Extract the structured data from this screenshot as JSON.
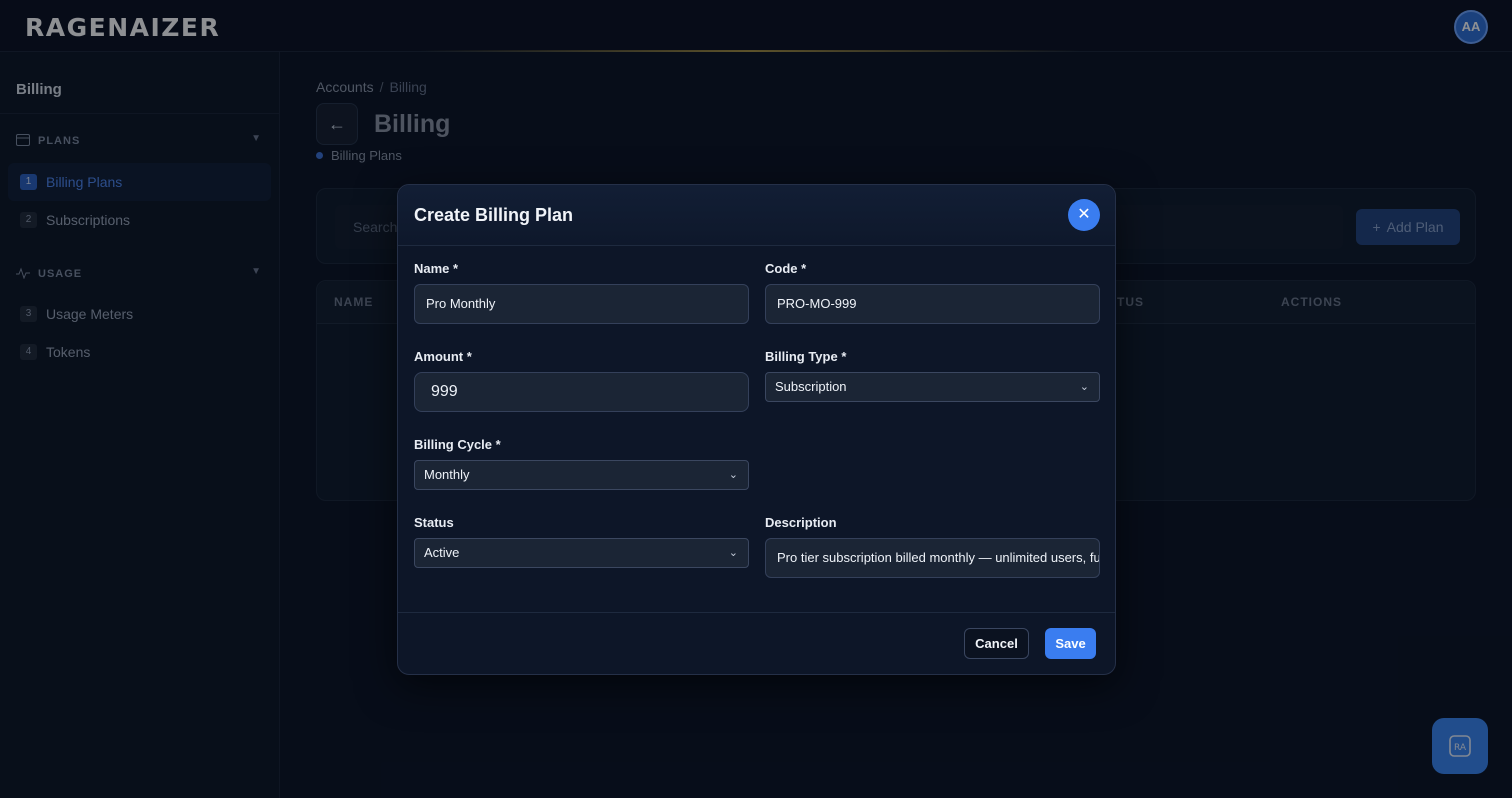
{
  "app": {
    "logo_text": "RAGENAIZER",
    "avatar_initials": "AA"
  },
  "sidebar": {
    "title": "Billing",
    "sections": [
      {
        "label": "PLANS",
        "icon": "credit-card-icon"
      },
      {
        "label": "USAGE",
        "icon": "activity-icon"
      }
    ],
    "items": [
      {
        "num": "1",
        "label": "Billing Plans"
      },
      {
        "num": "2",
        "label": "Subscriptions"
      },
      {
        "num": "3",
        "label": "Usage Meters"
      },
      {
        "num": "4",
        "label": "Tokens"
      }
    ]
  },
  "main": {
    "breadcrumb": {
      "root": "Accounts",
      "separator": "/",
      "current": "Billing"
    },
    "title": "Billing",
    "sub_label": "Billing Plans",
    "search_placeholder": "Search",
    "add_plan_label": "Add Plan",
    "table_headers": {
      "name": "NAME",
      "status": "TUS",
      "actions": "ACTIONS"
    }
  },
  "modal": {
    "title": "Create Billing Plan",
    "fields": {
      "name": {
        "label": "Name *",
        "value": "Pro Monthly"
      },
      "code": {
        "label": "Code *",
        "value": "PRO-MO-999"
      },
      "amount": {
        "label": "Amount *",
        "value": "999"
      },
      "billing_type": {
        "label": "Billing Type *",
        "value": "Subscription"
      },
      "billing_cycle": {
        "label": "Billing Cycle *",
        "value": "Monthly"
      },
      "status": {
        "label": "Status",
        "value": "Active"
      },
      "description": {
        "label": "Description",
        "value": "Pro tier subscription billed monthly — unlimited users, fu"
      }
    },
    "cancel_label": "Cancel",
    "save_label": "Save"
  },
  "colors": {
    "accent": "#3a7df0",
    "background": "#0a1222",
    "active_nav": "#4e86f0"
  }
}
